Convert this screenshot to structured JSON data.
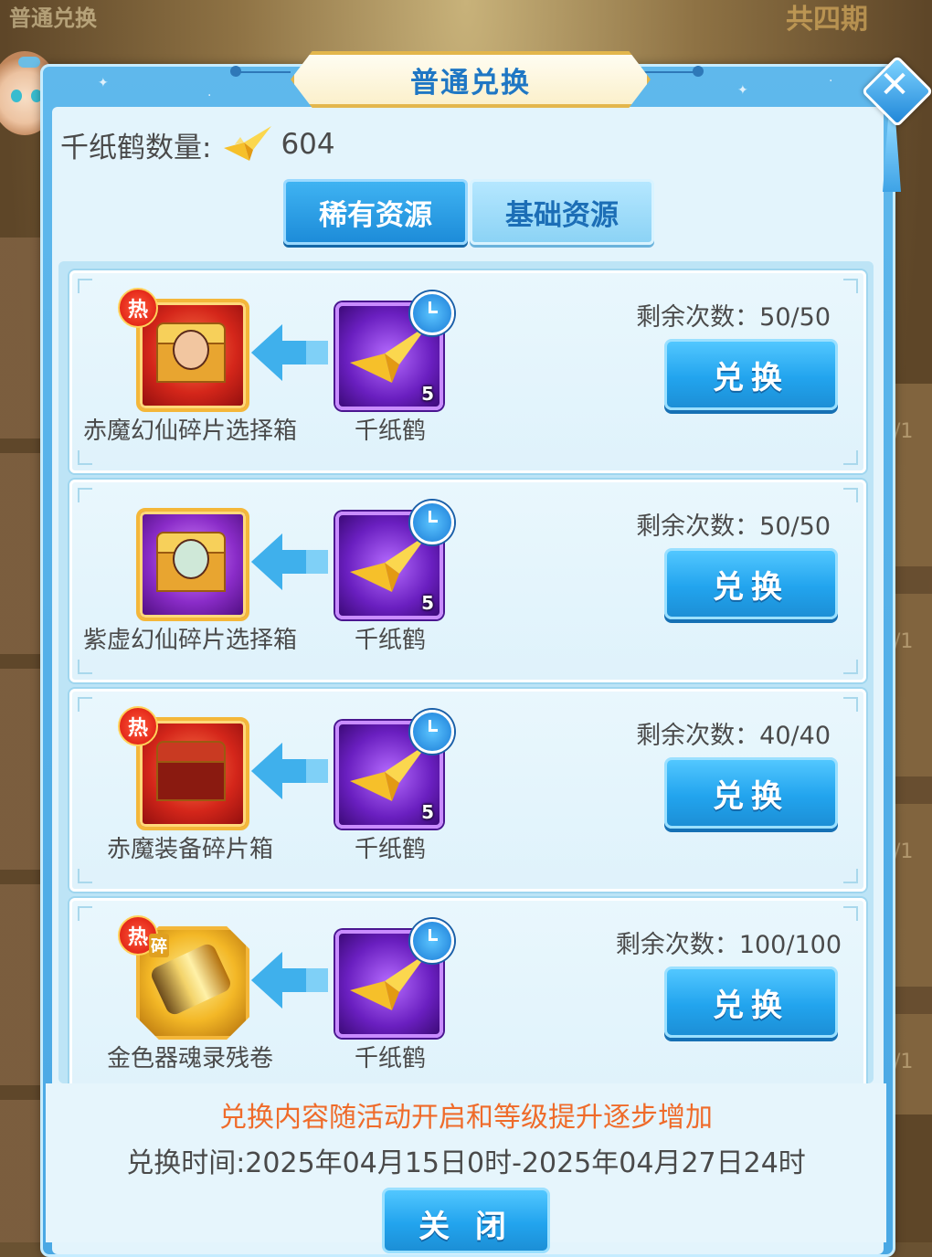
{
  "background": {
    "top_left_text": "普通兑换",
    "top_right_text": "共四期",
    "side_marks": [
      "/1",
      "/1",
      "/1",
      "/1"
    ]
  },
  "dialog": {
    "title": "普通兑换",
    "close_icon": "close-icon"
  },
  "currency": {
    "label": "千纸鹤数量:",
    "icon": "paper-crane-icon",
    "value": "604"
  },
  "tabs": [
    {
      "label": "稀有资源",
      "active": true
    },
    {
      "label": "基础资源",
      "active": false
    }
  ],
  "items": [
    {
      "reward_name": "赤魔幻仙碎片选择箱",
      "reward_icon": "red-chest-icon",
      "hot": "热",
      "fragment": "",
      "cost_name": "千纸鹤",
      "cost_count": "5",
      "remaining": "剩余次数：50/50",
      "button": "兑换"
    },
    {
      "reward_name": "紫虚幻仙碎片选择箱",
      "reward_icon": "purple-chest-icon",
      "hot": "",
      "fragment": "",
      "cost_name": "千纸鹤",
      "cost_count": "5",
      "remaining": "剩余次数：50/50",
      "button": "兑换"
    },
    {
      "reward_name": "赤魔装备碎片箱",
      "reward_icon": "red-equipment-chest-icon",
      "hot": "热",
      "fragment": "",
      "cost_name": "千纸鹤",
      "cost_count": "5",
      "remaining": "剩余次数：40/40",
      "button": "兑换"
    },
    {
      "reward_name": "金色器魂录残卷",
      "reward_icon": "gold-scroll-icon",
      "hot": "热",
      "fragment": "碎",
      "cost_name": "千纸鹤",
      "cost_count": "",
      "remaining": "剩余次数：100/100",
      "button": "兑换"
    }
  ],
  "footer": {
    "notice": "兑换内容随活动开启和等级提升逐步增加",
    "period": "兑换时间:2025年04月15日0时-2025年04月27日24时",
    "close_button": "关 闭"
  },
  "colors": {
    "accent_blue": "#22a4ee",
    "notice_orange": "#ef6b2a",
    "panel_bg": "#e3f4fc"
  }
}
